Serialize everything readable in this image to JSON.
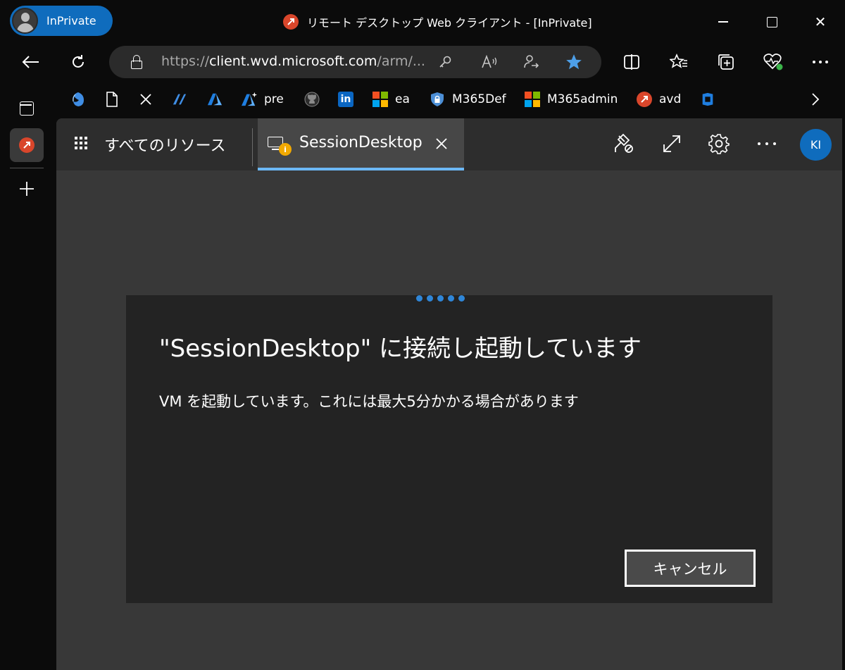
{
  "browser": {
    "inprivate_label": "InPrivate",
    "window_title": "リモート デスクトップ Web クライアント - [InPrivate]",
    "url": {
      "scheme": "https://",
      "host": "client.wvd.microsoft.com",
      "path": "/arm/..."
    },
    "window_controls": {
      "minimize": "",
      "maximize": "",
      "close": "✕"
    }
  },
  "favorites": [
    {
      "icon": "edge-dev-icon",
      "label": ""
    },
    {
      "icon": "page-icon",
      "label": ""
    },
    {
      "icon": "x-icon",
      "label": ""
    },
    {
      "icon": "azure-devops-icon",
      "label": ""
    },
    {
      "icon": "azure-icon",
      "label": ""
    },
    {
      "icon": "azure-preview-icon",
      "label": "pre"
    },
    {
      "icon": "github-icon",
      "label": ""
    },
    {
      "icon": "linkedin-icon",
      "label": ""
    },
    {
      "icon": "microsoft-icon",
      "label": "ea"
    },
    {
      "icon": "defender-icon",
      "label": "M365Def"
    },
    {
      "icon": "microsoft-icon",
      "label": "M365admin"
    },
    {
      "icon": "remote-desktop-icon",
      "label": "avd"
    },
    {
      "icon": "azure-vm-icon",
      "label": ""
    }
  ],
  "app": {
    "all_resources_label": "すべてのリソース",
    "session_tab_label": "SessionDesktop",
    "session_badge": "i",
    "user_initials": "KI"
  },
  "dialog": {
    "title": "\"SessionDesktop\" に接続し起動しています",
    "message": "VM を起動しています。これには最大5分かかる場合があります",
    "cancel_label": "キャンセル"
  },
  "colors": {
    "accent": "#0f6cbd",
    "tab_underline": "#6cb8f6",
    "progress": "#2f86d8",
    "remote_desktop_icon": "#d9462b"
  }
}
